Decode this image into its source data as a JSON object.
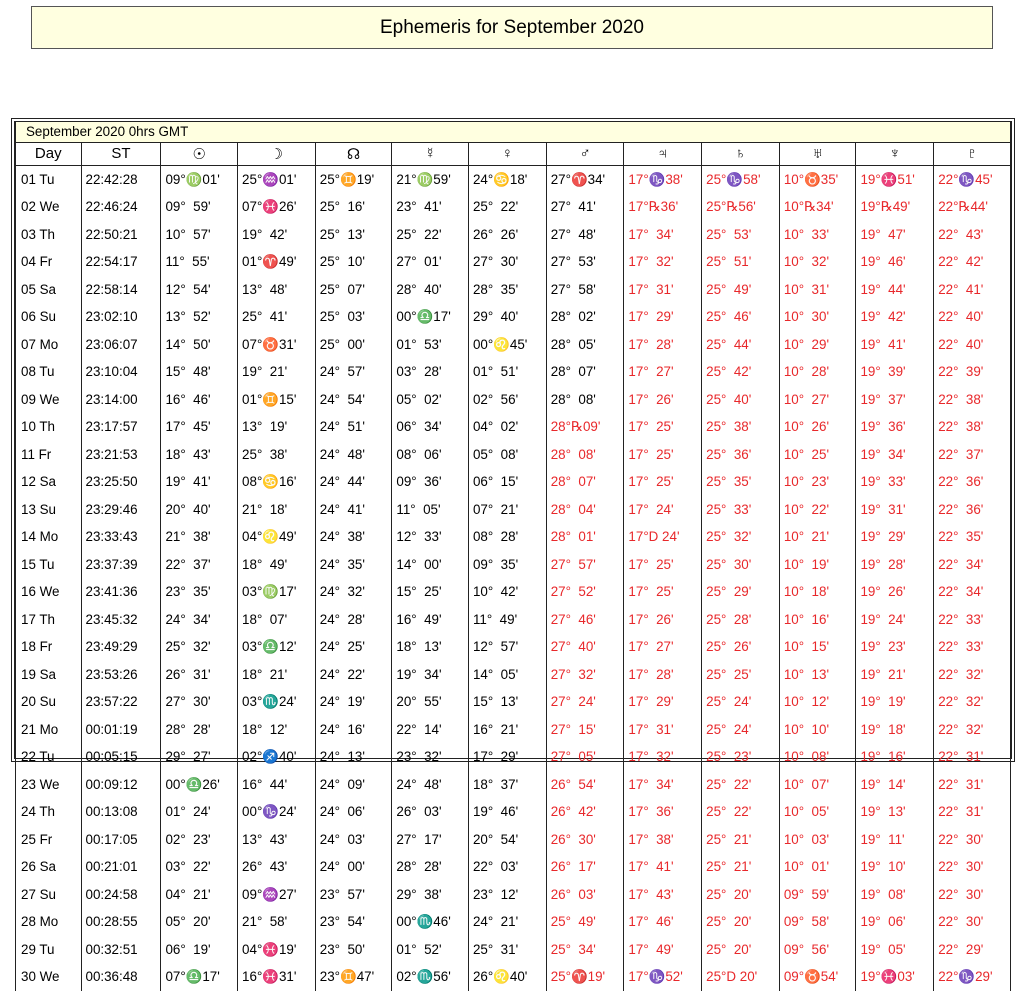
{
  "title": "Ephemeris for September 2020",
  "subtitle": "September 2020  0hrs GMT",
  "headers": [
    "Day",
    "ST",
    "☉",
    "☽",
    "☊",
    "☿",
    "♀",
    "♂",
    "♃",
    "♄",
    "♅",
    "♆",
    "♇"
  ],
  "red_color": "#e8282b",
  "groups": [
    [
      [
        "01 Tu",
        "22:42:28",
        "09°♍01'",
        "25°♒01'",
        "25°♊19'",
        "21°♍59'",
        "24°♋18'",
        "27°♈34'",
        "17°♑38'",
        "25°♑58'",
        "10°♉35'",
        "19°♓51'",
        "22°♑45'"
      ],
      [
        "02 We",
        "22:46:24",
        "09°  59'",
        "07°♓26'",
        "25°  16'",
        "23°  41'",
        "25°  22'",
        "27°  41'",
        "17°℞36'",
        "25°℞56'",
        "10°℞34'",
        "19°℞49'",
        "22°℞44'"
      ],
      [
        "03 Th",
        "22:50:21",
        "10°  57'",
        "19°  42'",
        "25°  13'",
        "25°  22'",
        "26°  26'",
        "27°  48'",
        "17°  34'",
        "25°  53'",
        "10°  33'",
        "19°  47'",
        "22°  43'"
      ],
      [
        "04 Fr",
        "22:54:17",
        "11°  55'",
        "01°♈49'",
        "25°  10'",
        "27°  01'",
        "27°  30'",
        "27°  53'",
        "17°  32'",
        "25°  51'",
        "10°  32'",
        "19°  46'",
        "22°  42'"
      ],
      [
        "05 Sa",
        "22:58:14",
        "12°  54'",
        "13°  48'",
        "25°  07'",
        "28°  40'",
        "28°  35'",
        "27°  58'",
        "17°  31'",
        "25°  49'",
        "10°  31'",
        "19°  44'",
        "22°  41'"
      ]
    ],
    [
      [
        "06 Su",
        "23:02:10",
        "13°  52'",
        "25°  41'",
        "25°  03'",
        "00°♎17'",
        "29°  40'",
        "28°  02'",
        "17°  29'",
        "25°  46'",
        "10°  30'",
        "19°  42'",
        "22°  40'"
      ],
      [
        "07 Mo",
        "23:06:07",
        "14°  50'",
        "07°♉31'",
        "25°  00'",
        "01°  53'",
        "00°♌45'",
        "28°  05'",
        "17°  28'",
        "25°  44'",
        "10°  29'",
        "19°  41'",
        "22°  40'"
      ],
      [
        "08 Tu",
        "23:10:04",
        "15°  48'",
        "19°  21'",
        "24°  57'",
        "03°  28'",
        "01°  51'",
        "28°  07'",
        "17°  27'",
        "25°  42'",
        "10°  28'",
        "19°  39'",
        "22°  39'"
      ],
      [
        "09 We",
        "23:14:00",
        "16°  46'",
        "01°♊15'",
        "24°  54'",
        "05°  02'",
        "02°  56'",
        "28°  08'",
        "17°  26'",
        "25°  40'",
        "10°  27'",
        "19°  37'",
        "22°  38'"
      ],
      [
        "10 Th",
        "23:17:57",
        "17°  45'",
        "13°  19'",
        "24°  51'",
        "06°  34'",
        "04°  02'",
        "28°℞09'",
        "17°  25'",
        "25°  38'",
        "10°  26'",
        "19°  36'",
        "22°  38'"
      ],
      [
        "11 Fr",
        "23:21:53",
        "18°  43'",
        "25°  38'",
        "24°  48'",
        "08°  06'",
        "05°  08'",
        "28°  08'",
        "17°  25'",
        "25°  36'",
        "10°  25'",
        "19°  34'",
        "22°  37'"
      ],
      [
        "12 Sa",
        "23:25:50",
        "19°  41'",
        "08°♋16'",
        "24°  44'",
        "09°  36'",
        "06°  15'",
        "28°  07'",
        "17°  25'",
        "25°  35'",
        "10°  23'",
        "19°  33'",
        "22°  36'"
      ]
    ],
    [
      [
        "13 Su",
        "23:29:46",
        "20°  40'",
        "21°  18'",
        "24°  41'",
        "11°  05'",
        "07°  21'",
        "28°  04'",
        "17°  24'",
        "25°  33'",
        "10°  22'",
        "19°  31'",
        "22°  36'"
      ],
      [
        "14 Mo",
        "23:33:43",
        "21°  38'",
        "04°♌49'",
        "24°  38'",
        "12°  33'",
        "08°  28'",
        "28°  01'",
        "17°D 24'",
        "25°  32'",
        "10°  21'",
        "19°  29'",
        "22°  35'"
      ],
      [
        "15 Tu",
        "23:37:39",
        "22°  37'",
        "18°  49'",
        "24°  35'",
        "14°  00'",
        "09°  35'",
        "27°  57'",
        "17°  25'",
        "25°  30'",
        "10°  19'",
        "19°  28'",
        "22°  34'"
      ],
      [
        "16 We",
        "23:41:36",
        "23°  35'",
        "03°♍17'",
        "24°  32'",
        "15°  25'",
        "10°  42'",
        "27°  52'",
        "17°  25'",
        "25°  29'",
        "10°  18'",
        "19°  26'",
        "22°  34'"
      ],
      [
        "17 Th",
        "23:45:32",
        "24°  34'",
        "18°  07'",
        "24°  28'",
        "16°  49'",
        "11°  49'",
        "27°  46'",
        "17°  26'",
        "25°  28'",
        "10°  16'",
        "19°  24'",
        "22°  33'"
      ],
      [
        "18 Fr",
        "23:49:29",
        "25°  32'",
        "03°♎12'",
        "24°  25'",
        "18°  13'",
        "12°  57'",
        "27°  40'",
        "17°  27'",
        "25°  26'",
        "10°  15'",
        "19°  23'",
        "22°  33'"
      ],
      [
        "19 Sa",
        "23:53:26",
        "26°  31'",
        "18°  21'",
        "24°  22'",
        "19°  34'",
        "14°  05'",
        "27°  32'",
        "17°  28'",
        "25°  25'",
        "10°  13'",
        "19°  21'",
        "22°  32'"
      ]
    ],
    [
      [
        "20 Su",
        "23:57:22",
        "27°  30'",
        "03°♏24'",
        "24°  19'",
        "20°  55'",
        "15°  13'",
        "27°  24'",
        "17°  29'",
        "25°  24'",
        "10°  12'",
        "19°  19'",
        "22°  32'"
      ],
      [
        "21 Mo",
        "00:01:19",
        "28°  28'",
        "18°  12'",
        "24°  16'",
        "22°  14'",
        "16°  21'",
        "27°  15'",
        "17°  31'",
        "25°  24'",
        "10°  10'",
        "19°  18'",
        "22°  32'"
      ],
      [
        "22 Tu",
        "00:05:15",
        "29°  27'",
        "02°♐40'",
        "24°  13'",
        "23°  32'",
        "17°  29'",
        "27°  05'",
        "17°  32'",
        "25°  23'",
        "10°  08'",
        "19°  16'",
        "22°  31'"
      ],
      [
        "23 We",
        "00:09:12",
        "00°♎26'",
        "16°  44'",
        "24°  09'",
        "24°  48'",
        "18°  37'",
        "26°  54'",
        "17°  34'",
        "25°  22'",
        "10°  07'",
        "19°  14'",
        "22°  31'"
      ],
      [
        "24 Th",
        "00:13:08",
        "01°  24'",
        "00°♑24'",
        "24°  06'",
        "26°  03'",
        "19°  46'",
        "26°  42'",
        "17°  36'",
        "25°  22'",
        "10°  05'",
        "19°  13'",
        "22°  31'"
      ],
      [
        "25 Fr",
        "00:17:05",
        "02°  23'",
        "13°  43'",
        "24°  03'",
        "27°  17'",
        "20°  54'",
        "26°  30'",
        "17°  38'",
        "25°  21'",
        "10°  03'",
        "19°  11'",
        "22°  30'"
      ],
      [
        "26 Sa",
        "00:21:01",
        "03°  22'",
        "26°  43'",
        "24°  00'",
        "28°  28'",
        "22°  03'",
        "26°  17'",
        "17°  41'",
        "25°  21'",
        "10°  01'",
        "19°  10'",
        "22°  30'"
      ]
    ],
    [
      [
        "27 Su",
        "00:24:58",
        "04°  21'",
        "09°♒27'",
        "23°  57'",
        "29°  38'",
        "23°  12'",
        "26°  03'",
        "17°  43'",
        "25°  20'",
        "09°  59'",
        "19°  08'",
        "22°  30'"
      ],
      [
        "28 Mo",
        "00:28:55",
        "05°  20'",
        "21°  58'",
        "23°  54'",
        "00°♏46'",
        "24°  21'",
        "25°  49'",
        "17°  46'",
        "25°  20'",
        "09°  58'",
        "19°  06'",
        "22°  30'"
      ],
      [
        "29 Tu",
        "00:32:51",
        "06°  19'",
        "04°♓19'",
        "23°  50'",
        "01°  52'",
        "25°  31'",
        "25°  34'",
        "17°  49'",
        "25°  20'",
        "09°  56'",
        "19°  05'",
        "22°  29'"
      ],
      [
        "30 We",
        "00:36:48",
        "07°♎17'",
        "16°♓31'",
        "23°♊47'",
        "02°♏56'",
        "26°♌40'",
        "25°♈19'",
        "17°♑52'",
        "25°D 20'",
        "09°♉54'",
        "19°♓03'",
        "22°♑29'"
      ]
    ]
  ]
}
